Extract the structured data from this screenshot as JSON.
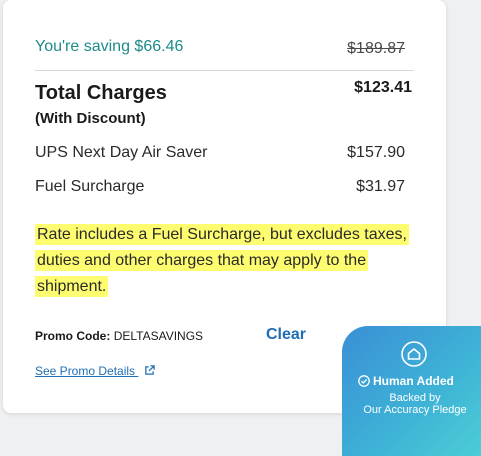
{
  "summary": {
    "saving_text": "You're saving $66.46",
    "original_price": "$189.87",
    "total_title": "Total Charges",
    "total_subtitle": "(With Discount)",
    "total_amount": "$123.41"
  },
  "line_items": [
    {
      "label": "UPS Next Day Air Saver",
      "value": "$157.90"
    },
    {
      "label": "Fuel Surcharge",
      "value": "$31.97"
    }
  ],
  "note": "Rate includes a Fuel Surcharge, but excludes taxes, duties and other charges that may apply to the shipment.",
  "promo": {
    "label": "Promo Code:",
    "code": "DELTASAVINGS",
    "clear_label": "Clear",
    "details_link": "See Promo Details"
  },
  "badge": {
    "title": "Human Added",
    "line1": "Backed by",
    "line2": "Our Accuracy Pledge"
  },
  "colors": {
    "saving": "#1e8a8a",
    "link": "#1f6db3",
    "highlight": "#fdfd6f",
    "badge_start": "#3a8fd6",
    "badge_end": "#4fd2d6"
  },
  "icons": {
    "external": "external-link-icon",
    "home": "home-icon",
    "check": "check-circle-icon"
  }
}
